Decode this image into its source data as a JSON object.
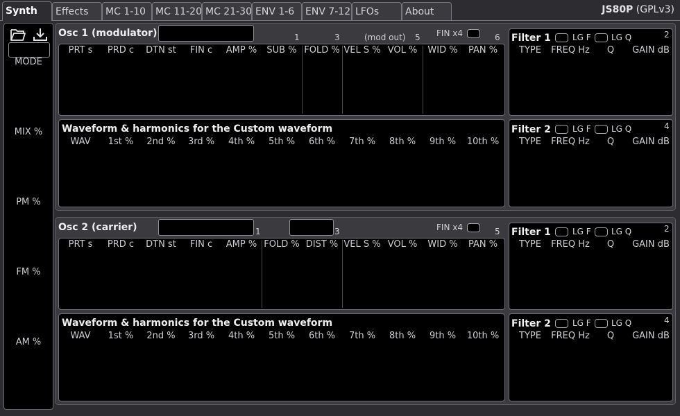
{
  "tabs": [
    {
      "label": "Synth",
      "active": true
    },
    {
      "label": "Effects"
    },
    {
      "label": "MC 1-10"
    },
    {
      "label": "MC 11-20"
    },
    {
      "label": "MC 21-30"
    },
    {
      "label": "ENV 1-6"
    },
    {
      "label": "ENV 7-12"
    },
    {
      "label": "LFOs"
    },
    {
      "label": "About"
    }
  ],
  "brand": {
    "name": "JS80P",
    "license": "(GPLv3)"
  },
  "sidebar": {
    "labels": [
      "MODE",
      "MIX %",
      "PM %",
      "FM %",
      "AM %"
    ],
    "icons": [
      "folder-open-icon",
      "download-icon"
    ]
  },
  "osc1": {
    "title": "Osc 1 (modulator)",
    "marks": [
      "1",
      "3",
      "(mod out)",
      "5",
      "6"
    ],
    "fin_label": "FIN x4",
    "headers": [
      "PRT s",
      "PRD c",
      "DTN st",
      "FIN c",
      "AMP %",
      "SUB %",
      "FOLD %",
      "VEL S %",
      "VOL %",
      "WID %",
      "PAN %"
    ],
    "wave_title": "Waveform & harmonics for the Custom waveform",
    "wave_headers": [
      "WAV",
      "1st %",
      "2nd %",
      "3rd %",
      "4th %",
      "5th %",
      "6th %",
      "7th %",
      "8th %",
      "9th %",
      "10th %"
    ]
  },
  "osc2": {
    "title": "Osc 2 (carrier)",
    "marks": [
      "1",
      "3",
      "5"
    ],
    "fin_label": "FIN x4",
    "headers": [
      "PRT s",
      "PRD c",
      "DTN st",
      "FIN c",
      "AMP %",
      "FOLD %",
      "DIST %",
      "VEL S %",
      "VOL %",
      "WID %",
      "PAN %"
    ],
    "wave_title": "Waveform & harmonics for the Custom waveform",
    "wave_headers": [
      "WAV",
      "1st %",
      "2nd %",
      "3rd %",
      "4th %",
      "5th %",
      "6th %",
      "7th %",
      "8th %",
      "9th %",
      "10th %"
    ]
  },
  "filters": {
    "filter1": {
      "title": "Filter 1",
      "lgf": "LG F",
      "lgq": "LG Q",
      "num": "2"
    },
    "filter2": {
      "title": "Filter 2",
      "lgf": "LG F",
      "lgq": "LG Q",
      "num": "4"
    },
    "headers": [
      "TYPE",
      "FREQ Hz",
      "Q",
      "GAIN dB"
    ]
  }
}
